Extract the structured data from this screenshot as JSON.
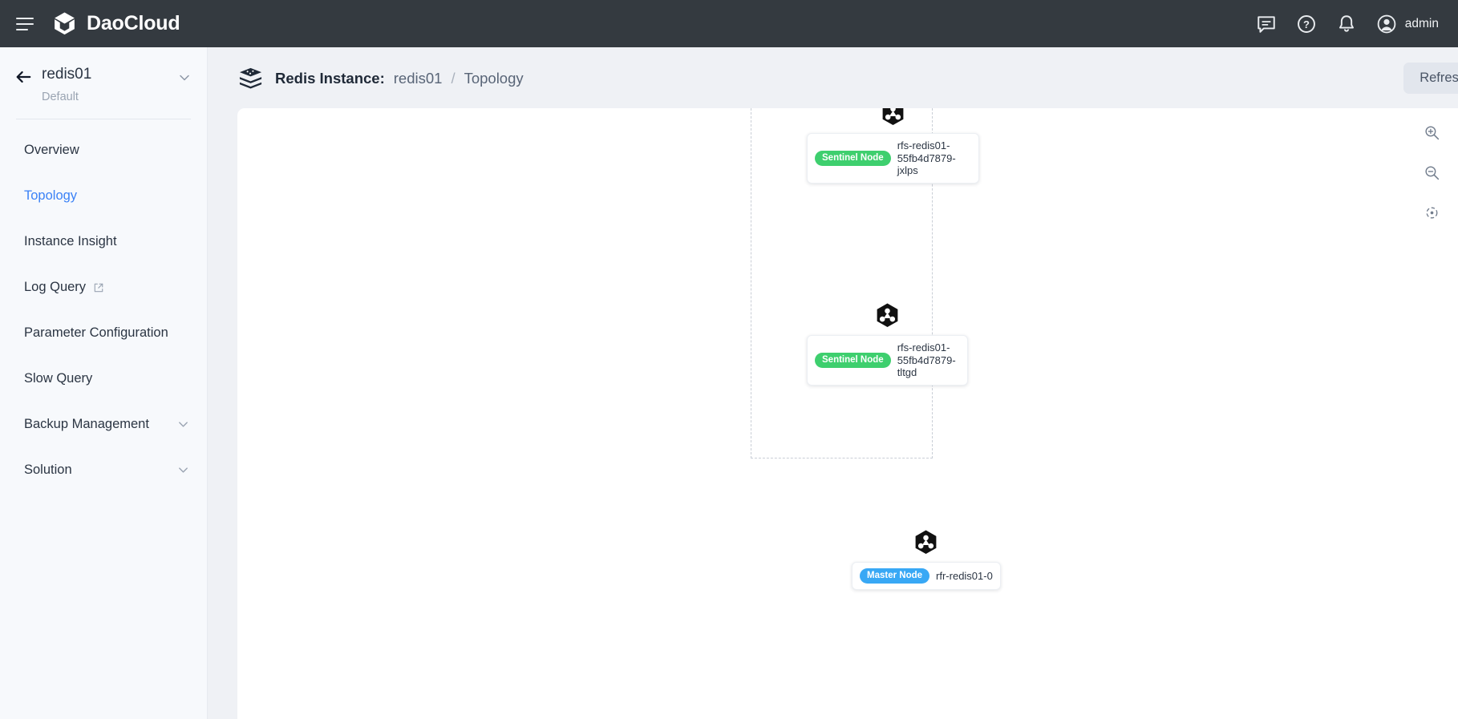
{
  "topbar": {
    "menu_icon": "hamburger-icon",
    "brand": "DaoCloud",
    "icons": [
      {
        "name": "chat-icon"
      },
      {
        "name": "help-icon"
      },
      {
        "name": "bell-icon"
      }
    ],
    "user": "admin",
    "avatar_icon": "user-avatar-icon",
    "background": "#343a40"
  },
  "sidebar": {
    "back_icon": "back-arrow-icon",
    "title": "redis01",
    "subtitle": "Default",
    "chevron_icon": "chevron-down-icon",
    "items": [
      {
        "label": "Overview",
        "active": false,
        "external": false,
        "expandable": false
      },
      {
        "label": "Topology",
        "active": true,
        "external": false,
        "expandable": false
      },
      {
        "label": "Instance Insight",
        "active": false,
        "external": false,
        "expandable": false
      },
      {
        "label": "Log Query",
        "active": false,
        "external": true,
        "expandable": false
      },
      {
        "label": "Parameter Configuration",
        "active": false,
        "external": false,
        "expandable": false
      },
      {
        "label": "Slow Query",
        "active": false,
        "external": false,
        "expandable": false
      },
      {
        "label": "Backup Management",
        "active": false,
        "external": false,
        "expandable": true
      },
      {
        "label": "Solution",
        "active": false,
        "external": false,
        "expandable": true
      }
    ],
    "active_color": "#3b82f6"
  },
  "breadcrumb": {
    "icon": "redis-stack-icon",
    "label": "Redis Instance:",
    "instance": "redis01",
    "separator": "/",
    "current": "Topology"
  },
  "toolbar": {
    "refresh_label": "Refresh"
  },
  "canvas": {
    "zoom_in_icon": "zoom-in-icon",
    "zoom_out_icon": "zoom-out-icon",
    "fit_view_icon": "fit-view-icon",
    "nodes": [
      {
        "id": "sentinel-1",
        "icon": "pod-hexagon-icon",
        "badge": "Sentinel Node",
        "badge_color": "#3ecf6e",
        "name": "rfs-redis01-55fb4d7879-jxlps"
      },
      {
        "id": "sentinel-2",
        "icon": "pod-hexagon-icon",
        "badge": "Sentinel Node",
        "badge_color": "#3ecf6e",
        "name": "rfs-redis01-55fb4d7879-tltgd"
      },
      {
        "id": "master",
        "icon": "pod-hexagon-icon",
        "badge": "Master Node",
        "badge_color": "#38a8f5",
        "name": "rfr-redis01-0"
      }
    ]
  }
}
